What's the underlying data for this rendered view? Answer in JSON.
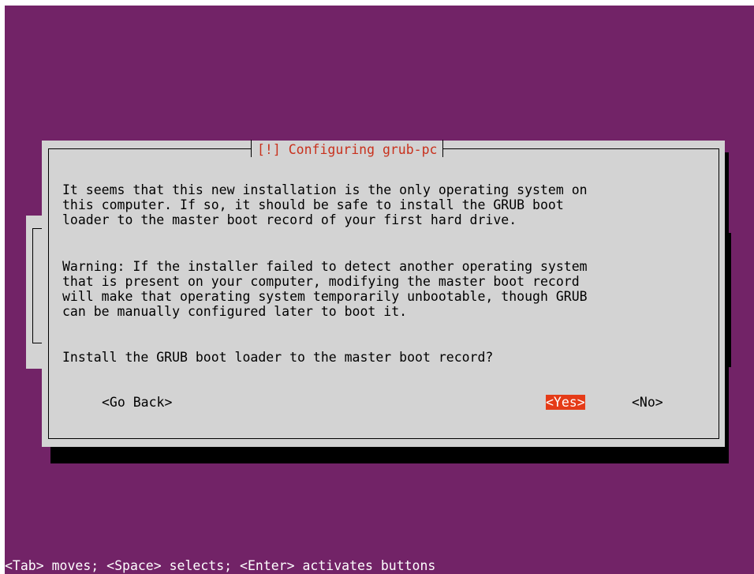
{
  "dialog": {
    "title": "[!] Configuring grub-pc",
    "paragraph1": [
      "It seems that this new installation is the only operating system on",
      "this computer. If so, it should be safe to install the GRUB boot",
      "loader to the master boot record of your first hard drive."
    ],
    "paragraph2": [
      "Warning: If the installer failed to detect another operating system",
      "that is present on your computer, modifying the master boot record",
      "will make that operating system temporarily unbootable, though GRUB",
      "can be manually configured later to boot it."
    ],
    "question": "Install the GRUB boot loader to the master boot record?",
    "buttons": {
      "go_back": "<Go Back>",
      "yes": "<Yes>",
      "no": "<No>"
    }
  },
  "footer": {
    "hint": "<Tab> moves; <Space> selects; <Enter> activates buttons"
  },
  "colors": {
    "background": "#722367",
    "dialog": "#d3d3d3",
    "title_text": "#c8311d",
    "selected_button": "#e53b17"
  }
}
